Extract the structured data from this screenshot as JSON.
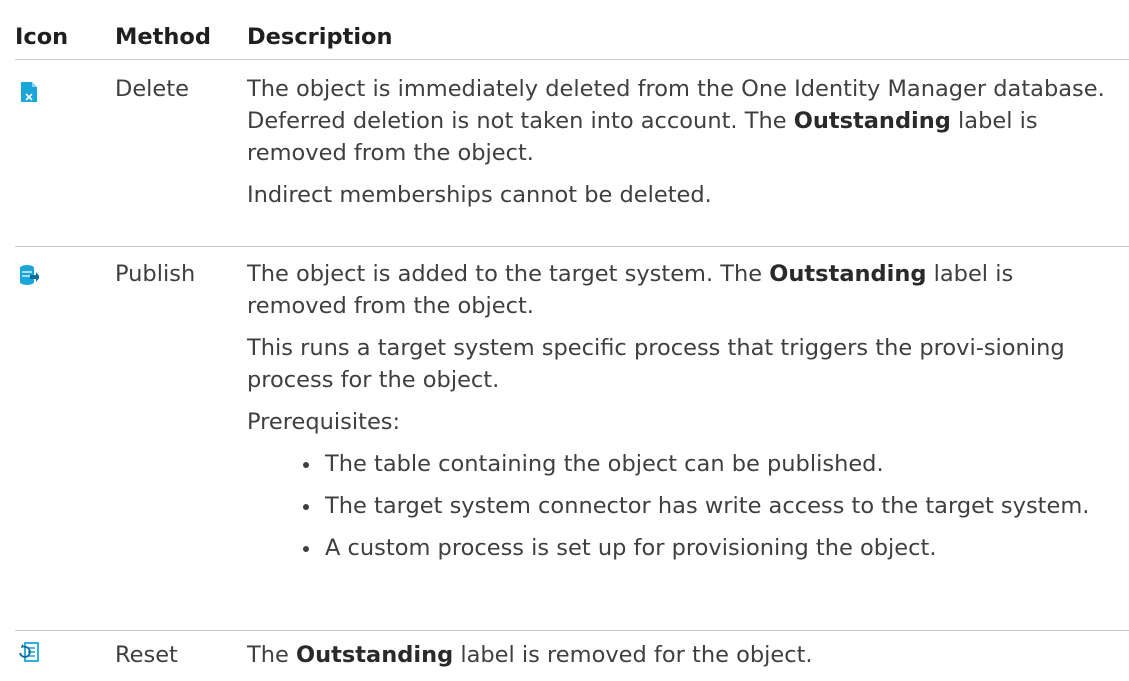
{
  "table": {
    "headers": {
      "icon": "Icon",
      "method": "Method",
      "description": "Description"
    },
    "rows": [
      {
        "icon": "delete-document-icon",
        "method": "Delete",
        "desc": {
          "p1a": "The object is immediately deleted from the One Identity Manager database. Deferred deletion is not taken into account. The ",
          "p1b": "Outstanding",
          "p1c": " label is removed from the object.",
          "p2": "Indirect memberships cannot be deleted."
        }
      },
      {
        "icon": "publish-database-icon",
        "method": "Publish",
        "desc": {
          "p1a": "The object is added to the target system. The ",
          "p1b": "Outstanding",
          "p1c": " label is removed from the object.",
          "p2": "This runs a target system specific process that triggers the provi-sioning process for the object.",
          "p3": "Prerequisites:",
          "bullets": [
            "The table containing the object can be published.",
            "The target system connector has write access to the target system.",
            "A custom process is set up for provisioning the object."
          ]
        }
      },
      {
        "icon": "reset-list-icon",
        "method": "Reset",
        "desc": {
          "p1a": "The ",
          "p1b": "Outstanding",
          "p1c": " label is removed for the object."
        }
      }
    ],
    "colors": {
      "accent": "#1aa6d9",
      "rule": "#c9c9c9",
      "text": "#3f3f3f"
    }
  }
}
